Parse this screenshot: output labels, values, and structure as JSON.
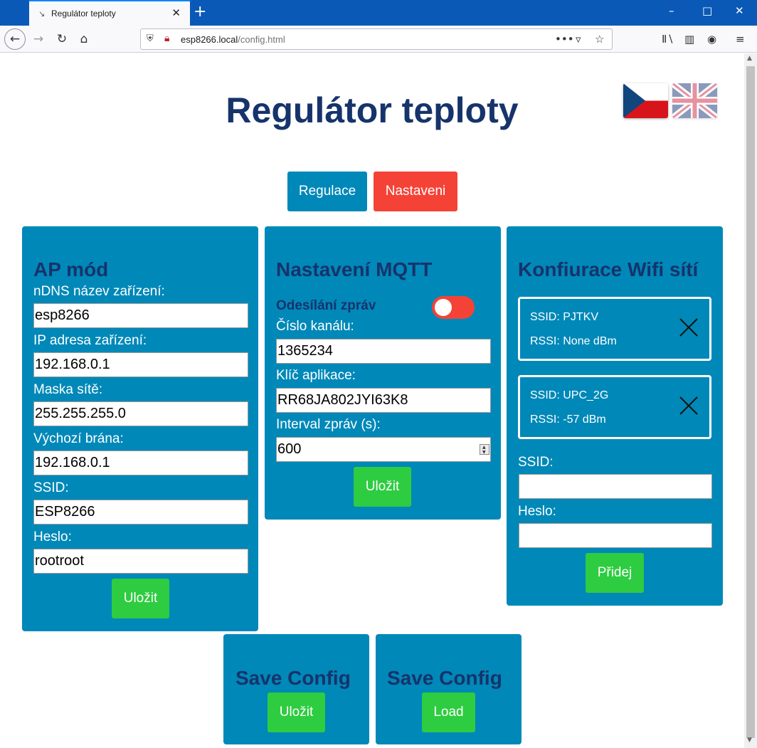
{
  "browser": {
    "tab_title": "Regulátor teploty",
    "url_host": "esp8266.local",
    "url_path": "/config.html"
  },
  "page": {
    "title": "Regulátor teploty"
  },
  "nav": {
    "regulace": "Regulace",
    "nastaveni": "Nastaveni"
  },
  "ap": {
    "title": "AP mód",
    "fields": [
      {
        "label": "nDNS název zařízení:",
        "value": "esp8266"
      },
      {
        "label": "IP adresa zařízení:",
        "value": "192.168.0.1"
      },
      {
        "label": "Maska sítě:",
        "value": "255.255.255.0"
      },
      {
        "label": "Výchozí brána:",
        "value": "192.168.0.1"
      },
      {
        "label": "SSID:",
        "value": "ESP8266"
      },
      {
        "label": "Heslo:",
        "value": "rootroot"
      }
    ],
    "save": "Uložit"
  },
  "mqtt": {
    "title": "Nastavení MQTT",
    "send_label": "Odesílání zpráv",
    "send_enabled": false,
    "channel_label": "Číslo kanálu:",
    "channel_value": "1365234",
    "key_label": "Klíč aplikace:",
    "key_value": "RR68JA802JYI63K8",
    "interval_label": "Interval zpráv (s):",
    "interval_value": "600",
    "save": "Uložit"
  },
  "wifi": {
    "title": "Konfiurace Wifi sítí",
    "networks": [
      {
        "ssid": "SSID: PJTKV",
        "rssi": "RSSI: None dBm"
      },
      {
        "ssid": "SSID: UPC_2G",
        "rssi": "RSSI: -57 dBm"
      }
    ],
    "ssid_label": "SSID:",
    "ssid_value": "",
    "pass_label": "Heslo:",
    "pass_value": "",
    "add": "Přidej"
  },
  "config_save": {
    "title": "Save Config",
    "button": "Uložit"
  },
  "config_load": {
    "title": "Save Config",
    "button": "Load"
  },
  "colors": {
    "panel": "#0088b8",
    "title_text": "#16336b",
    "green_button": "#2ecc40",
    "red": "#f44336"
  }
}
